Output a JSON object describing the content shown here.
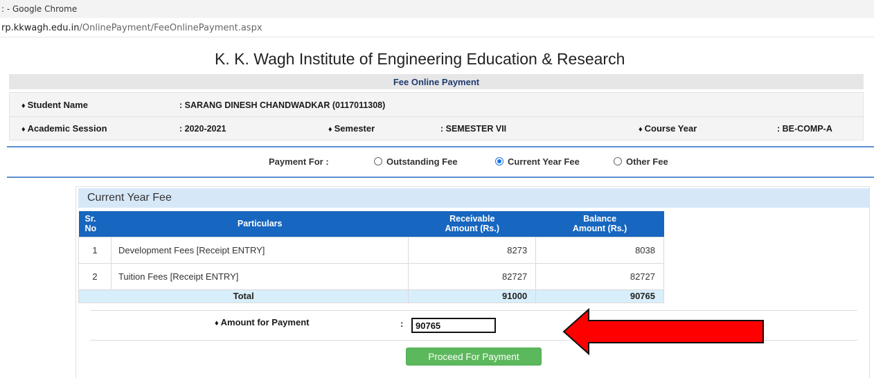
{
  "window": {
    "title": ": - Google Chrome",
    "url_host": "rp.kkwagh.edu.in",
    "url_path": "/OnlinePayment/FeeOnlinePayment.aspx"
  },
  "page": {
    "institute": "K. K. Wagh Institute of Engineering Education & Research",
    "section_title": "Fee Online Payment"
  },
  "student": {
    "name_label": "Student Name",
    "name_value": ":  SARANG DINESH CHANDWADKAR (0117011308)",
    "session_label": "Academic Session",
    "session_value": ":  2020-2021",
    "semester_label": "Semester",
    "semester_value": ":  SEMESTER VII",
    "course_label": "Course Year",
    "course_value": ":  BE-COMP-A"
  },
  "payment_for": {
    "label": "Payment For :",
    "options": [
      {
        "label": "Outstanding Fee",
        "selected": false
      },
      {
        "label": "Current Year Fee",
        "selected": true
      },
      {
        "label": "Other Fee",
        "selected": false
      }
    ]
  },
  "fee_section": {
    "title": "Current Year Fee",
    "headers": {
      "sr_line1": "Sr.",
      "sr_line2": "No",
      "particulars": "Particulars",
      "receivable_line1": "Receivable",
      "receivable_line2": "Amount (Rs.)",
      "balance_line1": "Balance",
      "balance_line2": "Amount (Rs.)"
    },
    "rows": [
      {
        "sr": "1",
        "particulars": "Development Fees [Receipt ENTRY]",
        "receivable": "8273",
        "balance": "8038"
      },
      {
        "sr": "2",
        "particulars": "Tuition Fees [Receipt ENTRY]",
        "receivable": "82727",
        "balance": "82727"
      }
    ],
    "total": {
      "label": "Total",
      "receivable": "91000",
      "balance": "90765"
    }
  },
  "amount": {
    "label": "Amount for Payment",
    "colon": ":",
    "value": "90765"
  },
  "proceed_label": "Proceed For Payment",
  "colors": {
    "table_header": "#1766bf",
    "section_header": "#d6e8f8",
    "total_row": "#d8eefb",
    "button": "#5cb85c",
    "arrow_fill": "#ff0000",
    "rule": "#5a8fd1"
  },
  "icons": {
    "label_tag": "tag-icon",
    "annotation": "red-arrow-icon"
  }
}
